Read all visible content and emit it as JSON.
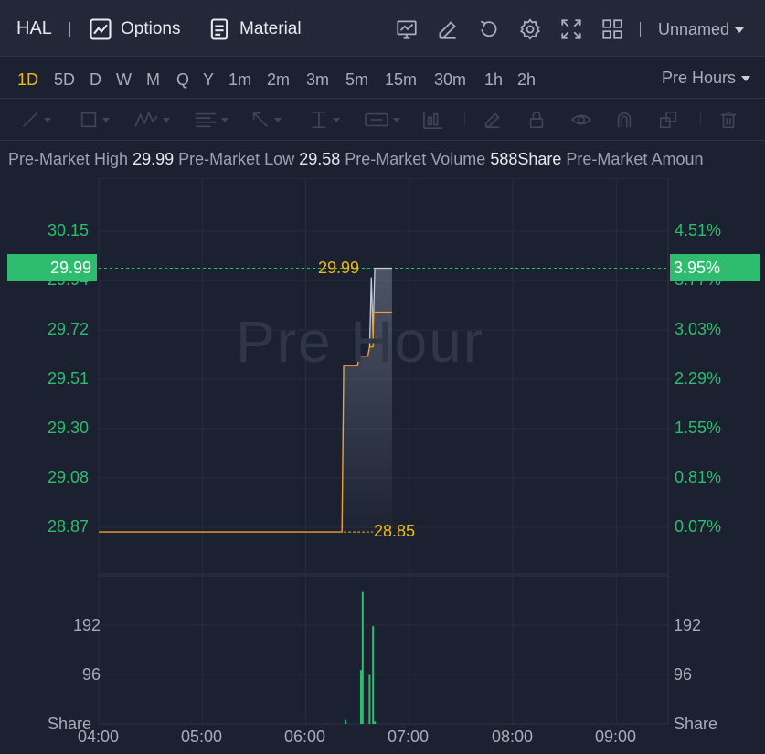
{
  "header": {
    "ticker": "HAL",
    "options_label": "Options",
    "material_label": "Material",
    "layout_name": "Unnamed",
    "icons": [
      "chart-icon",
      "edit-icon",
      "refresh-icon",
      "settings-icon",
      "fullscreen-icon",
      "grid-layout-icon"
    ]
  },
  "intervals": {
    "items": [
      "1D",
      "5D",
      "D",
      "W",
      "M",
      "Q",
      "Y",
      "1m",
      "2m",
      "3m",
      "5m",
      "15m",
      "30m",
      "1h",
      "2h"
    ],
    "active": "1D",
    "session_label": "Pre Hours"
  },
  "infobar": {
    "high_label": "Pre-Market High",
    "high_value": "29.99",
    "low_label": "Pre-Market Low",
    "low_value": "29.58",
    "volume_label": "Pre-Market Volume",
    "volume_value": "588Share",
    "amount_label": "Pre-Market Amoun"
  },
  "colors": {
    "up": "#2ebd6e",
    "price_line": "#f0a030",
    "annotation": "#f0b90b",
    "background": "#1b2130"
  },
  "chart_data": {
    "type": "line",
    "watermark": "Pre Hour",
    "price_axis_left": [
      "30.15",
      "29.94",
      "29.72",
      "29.51",
      "29.30",
      "29.08",
      "28.87"
    ],
    "percent_axis_right": [
      "4.51%",
      "3.77%",
      "3.03%",
      "2.29%",
      "1.55%",
      "0.81%",
      "0.07%"
    ],
    "current_price": "29.99",
    "current_percent": "3.95%",
    "high_annotation": "29.99",
    "low_annotation": "28.85",
    "ylim": [
      28.72,
      30.28
    ],
    "x_ticks": [
      "04:00",
      "05:00",
      "06:00",
      "07:00",
      "08:00",
      "09:00"
    ],
    "xlim": [
      "04:00",
      "09:30"
    ],
    "price_series": [
      {
        "t": "04:00",
        "p": 28.85
      },
      {
        "t": "06:21",
        "p": 28.85
      },
      {
        "t": "06:22",
        "p": 29.57
      },
      {
        "t": "06:30",
        "p": 29.57
      },
      {
        "t": "06:31",
        "p": 29.61
      },
      {
        "t": "06:36",
        "p": 29.61
      },
      {
        "t": "06:37",
        "p": 29.65
      },
      {
        "t": "06:39",
        "p": 29.65
      },
      {
        "t": "06:39",
        "p": 29.8
      },
      {
        "t": "06:41",
        "p": 29.8
      },
      {
        "t": "06:41",
        "p": 29.8
      },
      {
        "t": "06:50",
        "p": 29.8
      }
    ],
    "avg_series": [
      {
        "t": "06:37",
        "p": 29.65
      },
      {
        "t": "06:38",
        "p": 29.95
      },
      {
        "t": "06:39",
        "p": 29.7
      },
      {
        "t": "06:40",
        "p": 29.99
      },
      {
        "t": "06:50",
        "p": 29.99
      }
    ],
    "volume_axis": [
      "192",
      "96",
      "Share"
    ],
    "volume_max": 288,
    "volume_bars": [
      {
        "t": "06:23",
        "v": 8
      },
      {
        "t": "06:32",
        "v": 110
      },
      {
        "t": "06:33",
        "v": 270
      },
      {
        "t": "06:37",
        "v": 100
      },
      {
        "t": "06:39",
        "v": 200
      },
      {
        "t": "06:40",
        "v": 5
      }
    ]
  }
}
